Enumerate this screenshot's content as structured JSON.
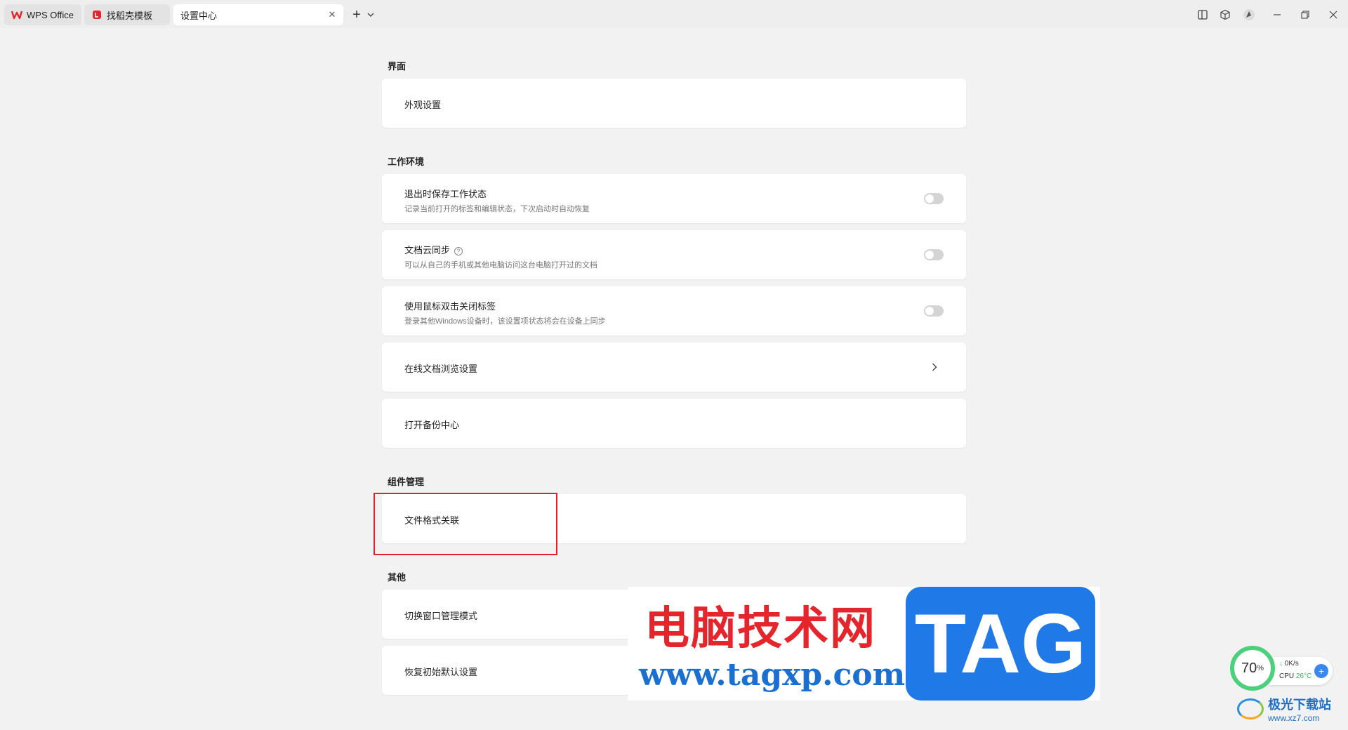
{
  "tabs": [
    {
      "label": "WPS Office"
    },
    {
      "label": "找稻壳模板"
    },
    {
      "label": "设置中心"
    }
  ],
  "sections": {
    "interface": {
      "title": "界面",
      "items": [
        {
          "label": "外观设置"
        }
      ]
    },
    "workspace": {
      "title": "工作环境",
      "items": [
        {
          "label": "退出时保存工作状态",
          "desc": "记录当前打开的标签和编辑状态，下次启动时自动恢复",
          "toggle": false
        },
        {
          "label": "文档云同步",
          "desc": "可以从自己的手机或其他电脑访问这台电脑打开过的文档",
          "toggle": false
        },
        {
          "label": "使用鼠标双击关闭标签",
          "desc": "登录其他Windows设备时，该设置项状态将会在设备上同步",
          "toggle": false
        },
        {
          "label": "在线文档浏览设置"
        },
        {
          "label": "打开备份中心"
        }
      ]
    },
    "components": {
      "title": "组件管理",
      "items": [
        {
          "label": "文件格式关联"
        }
      ]
    },
    "other": {
      "title": "其他",
      "items": [
        {
          "label": "切换窗口管理模式"
        },
        {
          "label": "恢复初始默认设置"
        }
      ]
    }
  },
  "watermark": {
    "cn": "电脑技术网",
    "url": "www.tagxp.com",
    "tag": "TAG"
  },
  "perf": {
    "percent": "70",
    "percent_unit": "%",
    "net": "0K/s",
    "cpu_label": "CPU",
    "cpu_temp": "26°C"
  },
  "site_logo": {
    "name": "极光下载站",
    "domain": "www.xz7.com"
  },
  "colors": {
    "highlight": "#e0232a",
    "wps_red": "#e5242b",
    "tag_blue": "#1f7ae8"
  }
}
